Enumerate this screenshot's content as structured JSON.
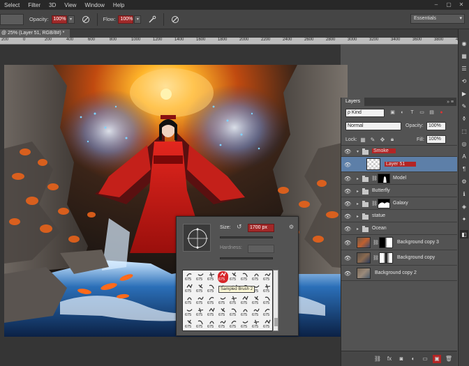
{
  "menu": {
    "items": [
      "Select",
      "Filter",
      "3D",
      "View",
      "Window",
      "Help"
    ]
  },
  "window_controls": {
    "minimize": "–",
    "maximize": "▢",
    "close": "✕"
  },
  "options_bar": {
    "opacity_label": "Opacity:",
    "opacity_value": "100%",
    "flow_label": "Flow:",
    "flow_value": "100%",
    "workspace": "Essentials",
    "accent_color": "#a02a2a"
  },
  "document": {
    "tab_title": "@ 25% (Layer 51, RGB/8#) *"
  },
  "ruler": {
    "ticks": [
      "200",
      "0",
      "200",
      "400",
      "600",
      "800",
      "1000",
      "1200",
      "1400",
      "1600",
      "1800",
      "2000",
      "2200",
      "2400",
      "2600",
      "2800",
      "3000",
      "3200",
      "3400",
      "3600",
      "3800",
      "4000"
    ]
  },
  "brush_picker": {
    "size_label": "Size:",
    "size_value": "1700 px",
    "hardness_label": "Hardness:",
    "tooltip": "Sampled Brush 2",
    "brush_size_number": "675",
    "selected_index": 3
  },
  "layers_panel": {
    "tab": "Layers",
    "menu_icon": "collapse-arrows-icon",
    "kind_filter": "ρ Kind",
    "blend_mode": "Normal",
    "opacity_label": "Opacity:",
    "opacity_value": "100%",
    "lock_label": "Lock:",
    "fill_label": "Fill:",
    "fill_value": "100%",
    "layers": [
      {
        "name": "Smoke",
        "type": "group",
        "expanded": true,
        "highlight": true
      },
      {
        "name": "Layer 51",
        "type": "layer",
        "selected": true
      },
      {
        "name": "Model",
        "type": "group-mask"
      },
      {
        "name": "Butterfly",
        "type": "group"
      },
      {
        "name": "Galaxy",
        "type": "group-mask"
      },
      {
        "name": "statue",
        "type": "group"
      },
      {
        "name": "Ocean",
        "type": "group"
      },
      {
        "name": "Background copy 3",
        "type": "layer-mask"
      },
      {
        "name": "Background copy",
        "type": "layer-mask"
      },
      {
        "name": "Background copy 2",
        "type": "layer"
      }
    ]
  }
}
